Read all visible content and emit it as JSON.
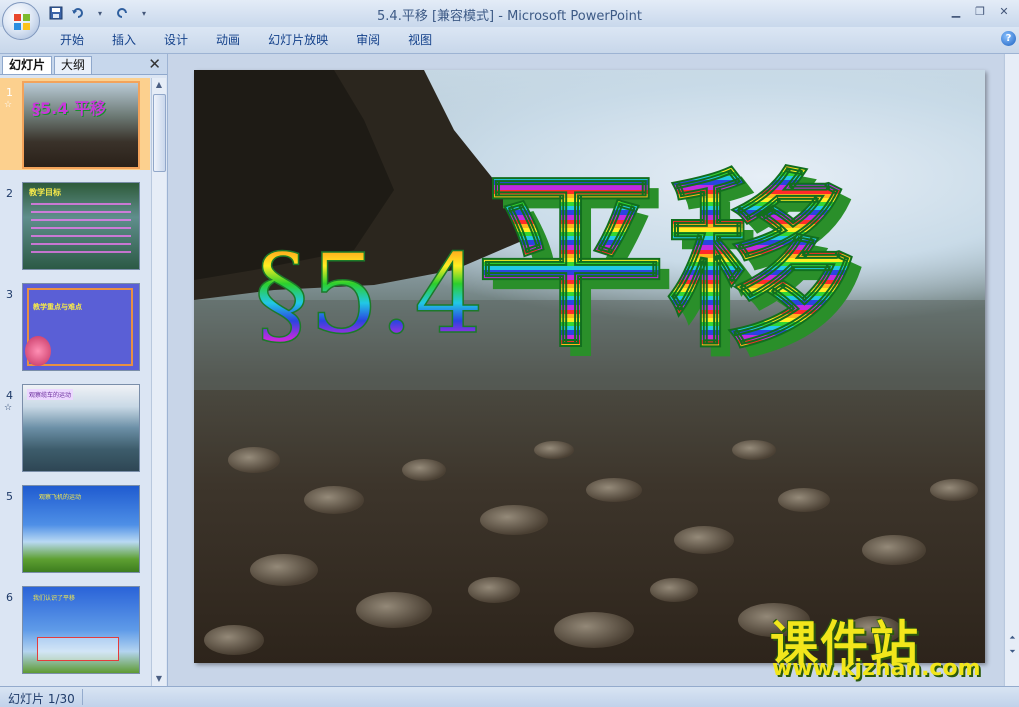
{
  "window": {
    "title": "5.4.平移 [兼容模式] - Microsoft PowerPoint"
  },
  "ribbon": {
    "tabs": [
      "开始",
      "插入",
      "设计",
      "动画",
      "幻灯片放映",
      "审阅",
      "视图"
    ]
  },
  "panel": {
    "tab_slides": "幻灯片",
    "tab_outline": "大纲",
    "close": "✕"
  },
  "thumbnails": [
    {
      "num": "1",
      "anim": "☆",
      "selected": true,
      "title": "§5.4 平移"
    },
    {
      "num": "2",
      "anim": "",
      "selected": false,
      "title": "教学目标"
    },
    {
      "num": "3",
      "anim": "",
      "selected": false,
      "title": "教学重点与难点"
    },
    {
      "num": "4",
      "anim": "☆",
      "selected": false,
      "title": "观察缆车的运动"
    },
    {
      "num": "5",
      "anim": "",
      "selected": false,
      "title": "观察飞机的运动"
    },
    {
      "num": "6",
      "anim": "",
      "selected": false,
      "title": "我们认识了平移"
    }
  ],
  "slide": {
    "section": "§5.4",
    "title": "平移"
  },
  "watermark": {
    "main": "课件站",
    "url": "www.kjzhan.com"
  },
  "status": {
    "slide_indicator": "幻灯片 1/30"
  },
  "colors": {
    "title_bar": "#dbe6f4",
    "selection": "#fcd08e",
    "watermark": "#f2e61b"
  }
}
